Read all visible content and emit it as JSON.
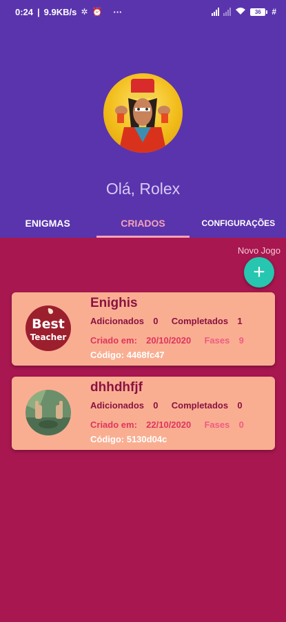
{
  "status_bar": {
    "time": "0:24",
    "speed": "9.9KB/s",
    "battery": "36",
    "more": "···"
  },
  "header": {
    "greeting": "Olá, Rolex"
  },
  "tabs": [
    {
      "label": "ENIGMAS",
      "active": false
    },
    {
      "label": "CRIADOS",
      "active": true
    },
    {
      "label": "CONFIGURAÇÕES",
      "active": false
    }
  ],
  "new_game": {
    "label": "Novo Jogo",
    "icon": "+"
  },
  "cards": [
    {
      "title": "Enighis",
      "added_label": "Adicionados",
      "added_value": "0",
      "completed_label": "Completados",
      "completed_value": "1",
      "created_label": "Criado em:",
      "created_value": "20/10/2020",
      "phases_label": "Fases",
      "phases_value": "9",
      "code_label": "Código:",
      "code_value": "4468fc47",
      "thumb_text_1": "Best",
      "thumb_text_2": "Teacher"
    },
    {
      "title": "dhhdhfjf",
      "added_label": "Adicionados",
      "added_value": "0",
      "completed_label": "Completados",
      "completed_value": "0",
      "created_label": "Criado em:",
      "created_value": "22/10/2020",
      "phases_label": "Fases",
      "phases_value": "0",
      "code_label": "Código:",
      "code_value": "5130d04c"
    }
  ],
  "colors": {
    "header_bg": "#5a34ad",
    "body_bg": "#a8174f",
    "card_bg": "#f9ae92",
    "fab": "#26c6b0",
    "active_tab": "#f4a3b7"
  }
}
